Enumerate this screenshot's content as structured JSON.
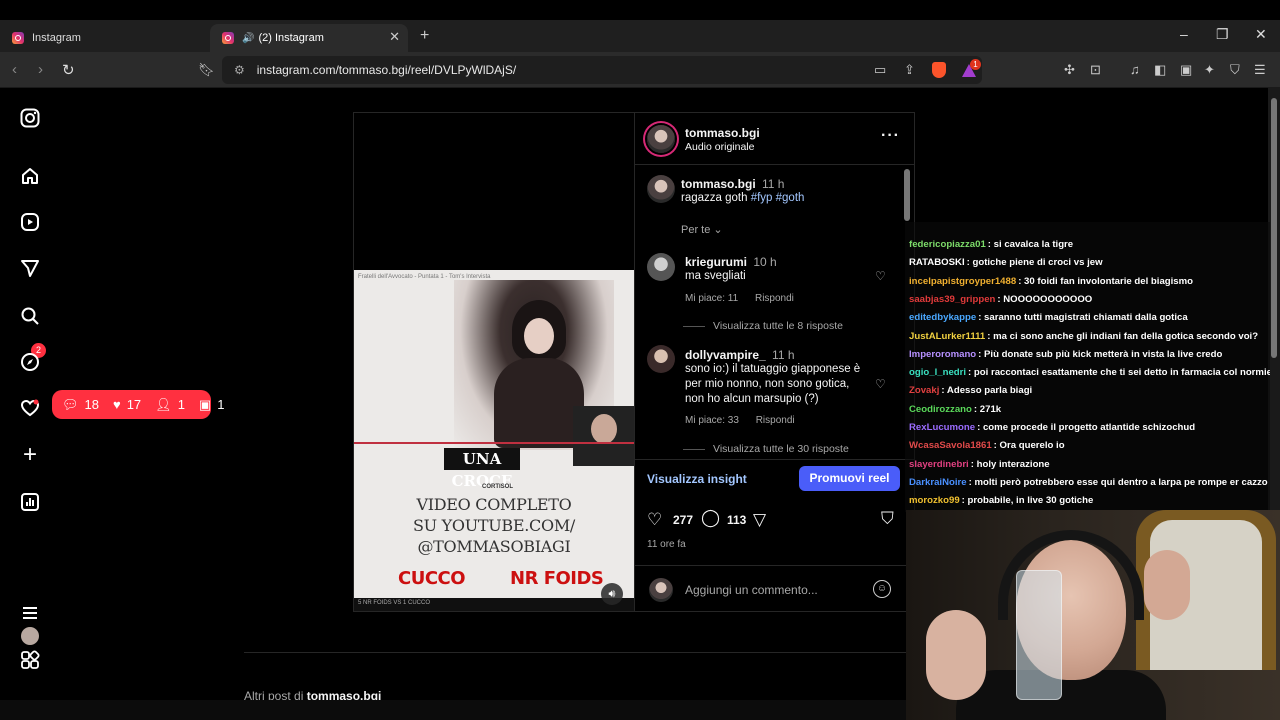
{
  "browser": {
    "tabs": [
      {
        "label": "Instagram"
      },
      {
        "label": "(2) Instagram"
      }
    ],
    "url": "instagram.com/tommaso.bgi/reel/DVLPyWlDAjS/",
    "rewards_badge": "1"
  },
  "sidebar": {
    "notifications_badge": "2",
    "activity": {
      "comments": "18",
      "likes": "17",
      "follows": "1",
      "requests": "1"
    }
  },
  "reel": {
    "top_caption": "Fratelli dell'Avvocato - Puntata 1 - Tom's Intervista",
    "caption_bar": "UNA CROCE",
    "cortisol_label": "CORTISOL",
    "video_text": [
      "VIDEO COMPLETO",
      "SU YOUTUBE.COM/",
      "@TOMMASOBIAGI"
    ],
    "red_left": "CUCCO",
    "red_right": "NR FOIDS",
    "bottom_strip": "5 NR FOIDS VS 1 CUCCO"
  },
  "post": {
    "author": "tommaso.bgi",
    "audio": "Audio originale",
    "caption_author": "tommaso.bgi",
    "caption_time": "11 h",
    "caption_text": "ragazza goth",
    "caption_tags": "#fyp #goth",
    "sort_label": "Per te",
    "comments": [
      {
        "user": "kriegurumi",
        "time": "10 h",
        "text": "ma svegliati",
        "likes": "Mi piace: 11",
        "reply": "Rispondi",
        "replies": "Visualizza tutte le 8 risposte"
      },
      {
        "user": "dollyvampire_",
        "time": "11 h",
        "text": "sono io:) il tatuaggio giapponese è per mio nonno, non sono gotica, non ho alcun marsupio (?)",
        "likes": "Mi piace: 33",
        "reply": "Rispondi",
        "replies": "Visualizza tutte le 30 risposte"
      }
    ],
    "insight_label": "Visualizza insight",
    "promote_label": "Promuovi reel",
    "likes_count": "277",
    "comments_count": "113",
    "time_ago": "11 ore fa",
    "add_comment_placeholder": "Aggiungi un commento..."
  },
  "more_posts": {
    "prefix": "Altri post di",
    "user": "tommaso.bgi"
  },
  "chat": [
    {
      "user": "federicopiazza01",
      "color": "#7ddc6a",
      "text": ": si cavalca la tigre"
    },
    {
      "user": "RATABOSKI",
      "color": "#ffffff",
      "text": ": gotiche piene di croci vs jew"
    },
    {
      "user": "incelpapistgroyper1488",
      "color": "#f0b030",
      "text": ": 30 foidi fan involontarie del biagismo"
    },
    {
      "user": "saabjas39_grippen",
      "color": "#e03a3a",
      "text": ": NOOOOOOOOOOO"
    },
    {
      "user": "editedbykappe",
      "color": "#4aa8ff",
      "text": ": saranno tutti magistrati chiamati dalla gotica"
    },
    {
      "user": "JustALurker1111",
      "color": "#f0d040",
      "text": ": ma ci sono anche gli indiani fan della gotica secondo voi?"
    },
    {
      "user": "Imperoromano",
      "color": "#b690ff",
      "text": ": Più donate sub più kick metterà in vista la live credo"
    },
    {
      "user": "ogio_l_nedri",
      "color": "#3ae0c0",
      "text": ": poi raccontaci esattamente che ti sei detto in farmacia col normie"
    },
    {
      "user": "Zovakj",
      "color": "#e04040",
      "text": ": Adesso parla biagi"
    },
    {
      "user": "Ceodirozzano",
      "color": "#5ad85a",
      "text": ": 271k"
    },
    {
      "user": "RexLucumone",
      "color": "#9b6cff",
      "text": ": come procede il progetto atlantide schizochud"
    },
    {
      "user": "WcasaSavola1861",
      "color": "#e04a4a",
      "text": ": Ora querelo io"
    },
    {
      "user": "slayerdinebri",
      "color": "#e04080",
      "text": ": holy interazione"
    },
    {
      "user": "DarkraiNoire",
      "color": "#4a90ff",
      "text": ": molti però potrebbero esse qui dentro a larpa pe rompe er cazzo"
    },
    {
      "user": "morozko99",
      "color": "#f0c030",
      "text": ": probabile, in live 30 gotiche"
    }
  ]
}
